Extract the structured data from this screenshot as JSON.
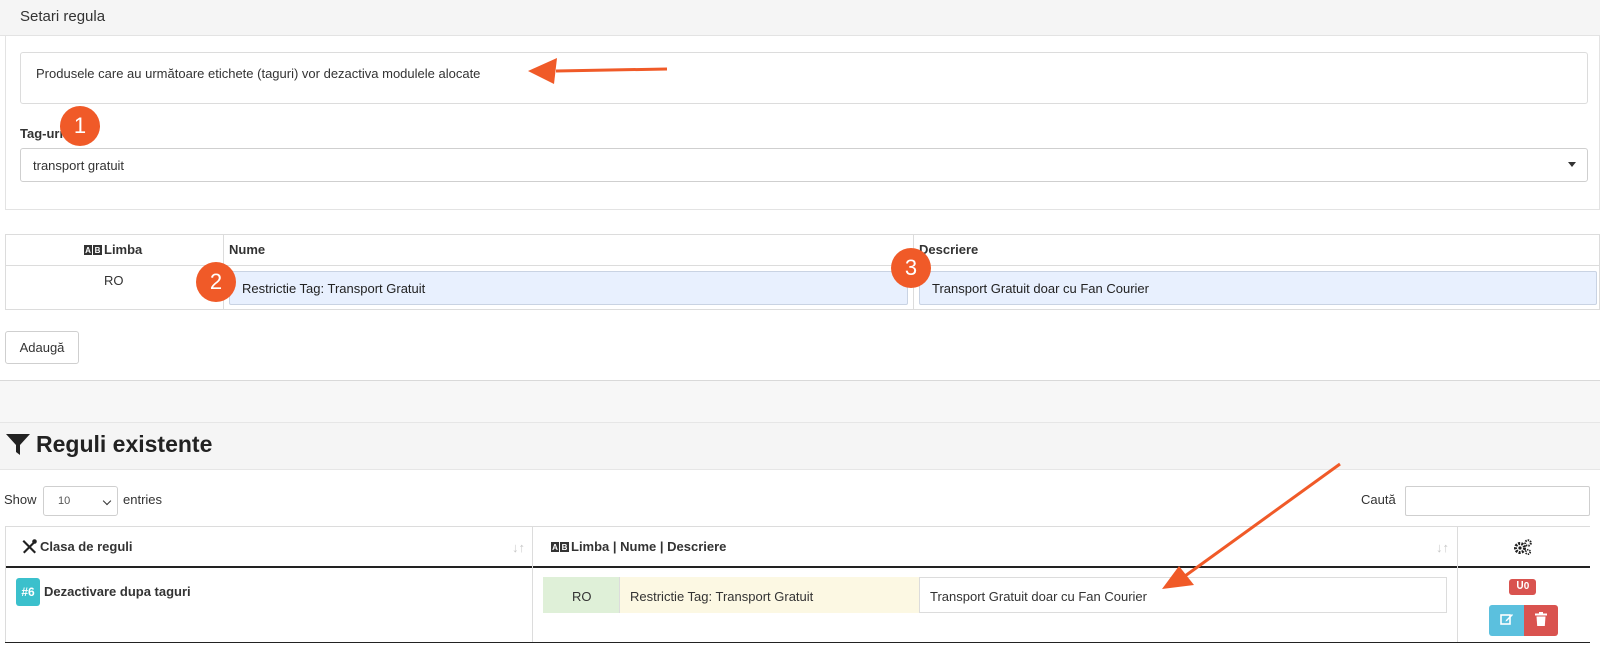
{
  "settings": {
    "panel_title": "Setari regula",
    "info_text": "Produsele care au următoare etichete (taguri) vor dezactiva modulele alocate",
    "tags_label": "Tag-uri",
    "tags_value": "transport gratuit"
  },
  "language_table": {
    "col_language": "Limba",
    "col_name": "Nume",
    "col_description": "Descriere",
    "row": {
      "language": "RO",
      "name": "Restrictie Tag: Transport Gratuit",
      "description": "Transport Gratuit doar cu Fan Courier"
    },
    "add_button": "Adaugă"
  },
  "existing_rules": {
    "title": "Reguli existente",
    "show_label": "Show",
    "entries_value": "10",
    "entries_label": "entries",
    "search_label": "Caută",
    "col_class": "Clasa de reguli",
    "col_lang_name_desc": "Limba | Nume | Descriere",
    "rows": [
      {
        "id": "#6",
        "class_name": "Dezactivare dupa taguri",
        "language": "RO",
        "name": "Restrictie Tag: Transport Gratuit",
        "description": "Transport Gratuit doar cu Fan Courier",
        "user_badge": "0"
      }
    ]
  },
  "markers": [
    "1",
    "2",
    "3"
  ],
  "colors": {
    "accent": "#f05a28",
    "info": "#5bc0de",
    "danger": "#d9534f",
    "success_bg": "#dff0d8",
    "warning_bg": "#fcf8e3",
    "id_badge": "#3bc0cc"
  },
  "icons": {
    "language": "language-icon",
    "tools": "wrench-screwdriver-icon",
    "filter": "filter-icon",
    "settings": "cogs-icon",
    "edit": "edit-icon",
    "delete": "trash-icon",
    "user": "user-icon",
    "sort": "sort-icon"
  }
}
